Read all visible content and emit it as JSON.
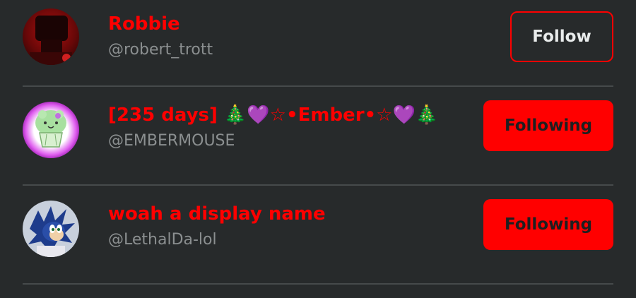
{
  "users": [
    {
      "display_name": "Robbie",
      "handle": "@robert_trott",
      "button_label": "Follow",
      "state": "not-following",
      "avatar_icon": "dark-red-silhouette-avatar"
    },
    {
      "display_name": "[235 days] 🎄💜☆•Ember•☆💜🎄",
      "handle": "@EMBERMOUSE",
      "button_label": "Following",
      "state": "following",
      "avatar_icon": "green-cupcake-cat-avatar"
    },
    {
      "display_name": "woah a display name",
      "handle": "@LethalDa-lol",
      "button_label": "Following",
      "state": "following",
      "avatar_icon": "blue-hedgehog-avatar"
    }
  ],
  "colors": {
    "background": "#272a2b",
    "accent": "#ff0000",
    "handle": "#8b8f90",
    "divider": "#464a4b"
  }
}
